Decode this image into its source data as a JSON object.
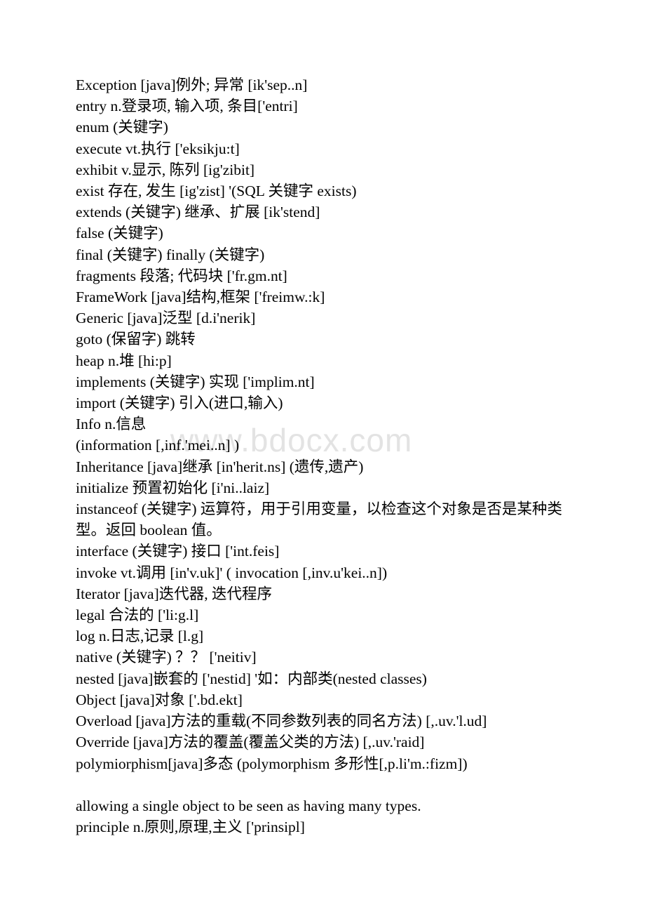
{
  "document": {
    "watermark": "www.bdocx.com",
    "page_background": "#ffffff",
    "text_color": "#000000",
    "watermark_color": "#e3e3e3",
    "lines": [
      "Exception [java]例外; 异常 [ik'sep..n]",
      "entry n.登录项, 输入项, 条目['entri]",
      "enum (关键字)",
      "execute vt.执行 ['eksikju:t]",
      "exhibit v.显示, 陈列 [ig'zibit]",
      "exist 存在, 发生 [ig'zist] '(SQL 关键字 exists)",
      "extends (关键字) 继承、扩展 [ik'stend]",
      "false (关键字)",
      "final (关键字) finally (关键字)",
      "fragments 段落; 代码块 ['fr.gm.nt]",
      "FrameWork [java]结构,框架 ['freimw.:k]",
      "Generic [java]泛型 [d.i'nerik]",
      "goto (保留字) 跳转",
      "heap n.堆 [hi:p]",
      "implements (关键字) 实现 ['implim.nt]",
      "import (关键字) 引入(进口,输入)",
      "Info n.信息",
      "(information [,inf.'mei..n] )",
      "Inheritance [java]继承 [in'herit.ns] (遗传,遗产)",
      "initialize 预置初始化 [i'ni..laiz]",
      "instanceof (关键字) 运算符，用于引用变量，以检查这个对象是否是某种类型。返回 boolean 值。",
      "interface (关键字) 接口 ['int.feis]",
      "invoke vt.调用 [in'v.uk]' ( invocation [,inv.u'kei..n])",
      "Iterator [java]迭代器, 迭代程序",
      "legal 合法的 ['li:g.l]",
      "log n.日志,记录 [l.g]",
      "native (关键字) ？？ ['neitiv]",
      "nested [java]嵌套的 ['nestid] '如：内部类(nested classes)",
      "Object [java]对象 ['.bd.ekt]",
      "Overload [java]方法的重载(不同参数列表的同名方法) [,.uv.'l.ud]",
      "Override [java]方法的覆盖(覆盖父类的方法) [,.uv.'raid]",
      "polymiorphism[java]多态 (polymorphism 多形性[,p.li'm.:fizm])",
      "",
      "allowing a single object to be seen as having many types.",
      "principle n.原则,原理,主义 ['prinsipl]"
    ]
  }
}
